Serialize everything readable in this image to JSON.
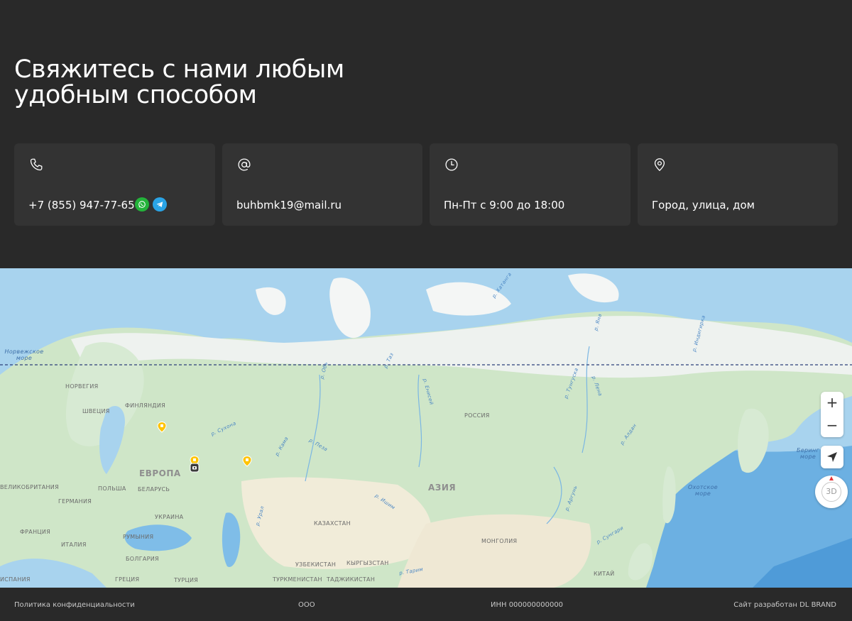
{
  "hero": {
    "title_line1": "Свяжитесь с нами любым",
    "title_line2": "удобным способом"
  },
  "contacts": [
    {
      "icon": "phone-icon",
      "value": "+7 (855) 947-77-65"
    },
    {
      "icon": "at-icon",
      "value": "buhbmk19@mail.ru"
    },
    {
      "icon": "clock-icon",
      "value": "Пн-Пт с 9:00 до 18:00"
    },
    {
      "icon": "location-pin-icon",
      "value": "Город, улица, дом"
    }
  ],
  "messengers": [
    {
      "icon": "whatsapp-icon",
      "color": "#23b33a"
    },
    {
      "icon": "telegram-icon",
      "color": "#2aa4e6"
    }
  ],
  "map": {
    "labels": {
      "europe": "ЕВРОПА",
      "asia": "АЗИЯ",
      "russia": "РОССИЯ",
      "norway": "НОРВЕГИЯ",
      "sweden": "ШВЕЦИЯ",
      "finland": "ФИНЛЯНДИЯ",
      "poland": "ПОЛЬША",
      "belarus": "БЕЛАРУСЬ",
      "germany": "ГЕРМАНИЯ",
      "ukraine": "УКРАИНА",
      "france": "ФРАНЦИЯ",
      "italy": "ИТАЛИЯ",
      "romania": "РУМЫНИЯ",
      "bulgaria": "БОЛГАРИЯ",
      "greece": "ГРЕЦИЯ",
      "turkey": "ТУРЦИЯ",
      "spain": "ИСПАНИЯ",
      "britain": "ВЕЛИКОБРИТАНИЯ",
      "kazakhstan": "КАЗАХСТАН",
      "mongolia": "МОНГОЛИЯ",
      "uzbekistan": "УЗБЕКИСТАН",
      "kyrgyzstan": "КЫРГЫЗСТАН",
      "turkmenistan": "ТУРКМЕНИСТАН",
      "tajikistan": "ТАДЖИКИСТАН",
      "china": "КИТАЙ",
      "norwegian_sea_1": "Норвежское",
      "norwegian_sea_2": "море",
      "okhotsk_sea_1": "Охотское",
      "okhotsk_sea_2": "море",
      "bering_sea_1": "Беринг",
      "bering_sea_2": "море",
      "river_ob": "р. Обь",
      "river_sukhona": "р. Сухона",
      "river_kama": "р. Кама",
      "river_peza": "р. Пеза",
      "river_ural": "р. Урал",
      "river_ishim": "р. Ишим",
      "river_taz": "р. Таз",
      "river_yenisei": "р. Енисей",
      "river_lena": "р. Лена",
      "river_tunguska": "р. Тунгуска",
      "river_aldan": "р. Алдан",
      "river_khatanga": "р. Хатанга",
      "river_yana": "р. Яна",
      "river_indigirka": "р. Индигирка",
      "river_argun": "р. Аргунь",
      "river_sungari": "р. Сунгари",
      "river_tarim": "р. Тарим"
    },
    "controls": {
      "zoom_in": "+",
      "zoom_out": "−",
      "mode_3d": "3D"
    }
  },
  "footer": {
    "privacy": "Политика конфиденциальности",
    "company": "ООО",
    "inn": "ИНН 000000000000",
    "developer": "Сайт разработан DL BRAND"
  }
}
